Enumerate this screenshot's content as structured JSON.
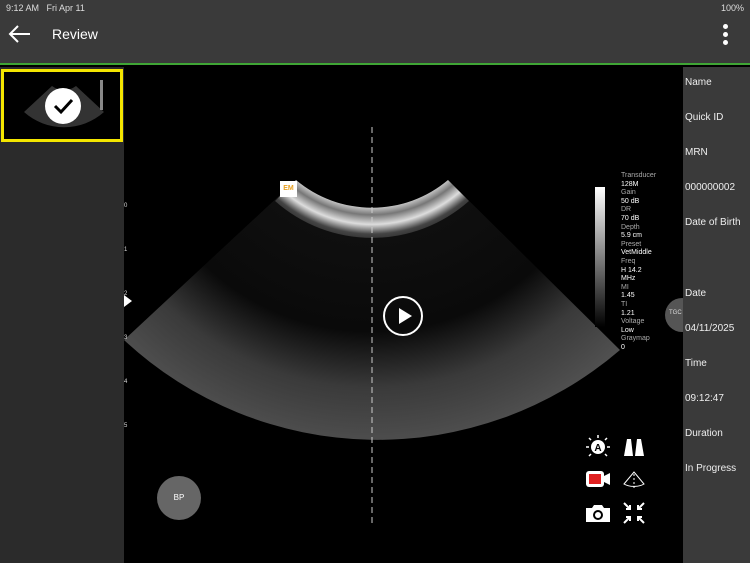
{
  "status": {
    "time": "9:12 AM",
    "date": "Fri Apr 11",
    "battery": "100%"
  },
  "header": {
    "title": "Review"
  },
  "image": {
    "marker": "EM",
    "depth_ticks": [
      "0",
      "1",
      "2",
      "3",
      "4",
      "5"
    ],
    "tgc": "TGC",
    "bp": "BP",
    "params": [
      [
        "Transducer",
        "128M"
      ],
      [
        "Gain",
        "50 dB"
      ],
      [
        "DR",
        "70 dB"
      ],
      [
        "Depth",
        "5.9 cm"
      ],
      [
        "Preset",
        "VetMiddle"
      ],
      [
        "Freq",
        "H 14.2"
      ],
      [
        "",
        "MHz"
      ],
      [
        "MI",
        "1.45"
      ],
      [
        "TI",
        "1.21"
      ],
      [
        "Voltage",
        "Low"
      ],
      [
        "Graymap",
        "0"
      ]
    ]
  },
  "info": {
    "name": "Name",
    "quick_id": "Quick ID",
    "mrn": "MRN",
    "mrn_value": "000000002",
    "dob": "Date of Birth",
    "date": "Date",
    "date_value": "04/11/2025",
    "time": "Time",
    "time_value": "09:12:47",
    "duration": "Duration",
    "duration_value": "In Progress"
  },
  "colors": {
    "accent": "#3fa535",
    "selection": "#f4e600",
    "record": "#e02020"
  }
}
